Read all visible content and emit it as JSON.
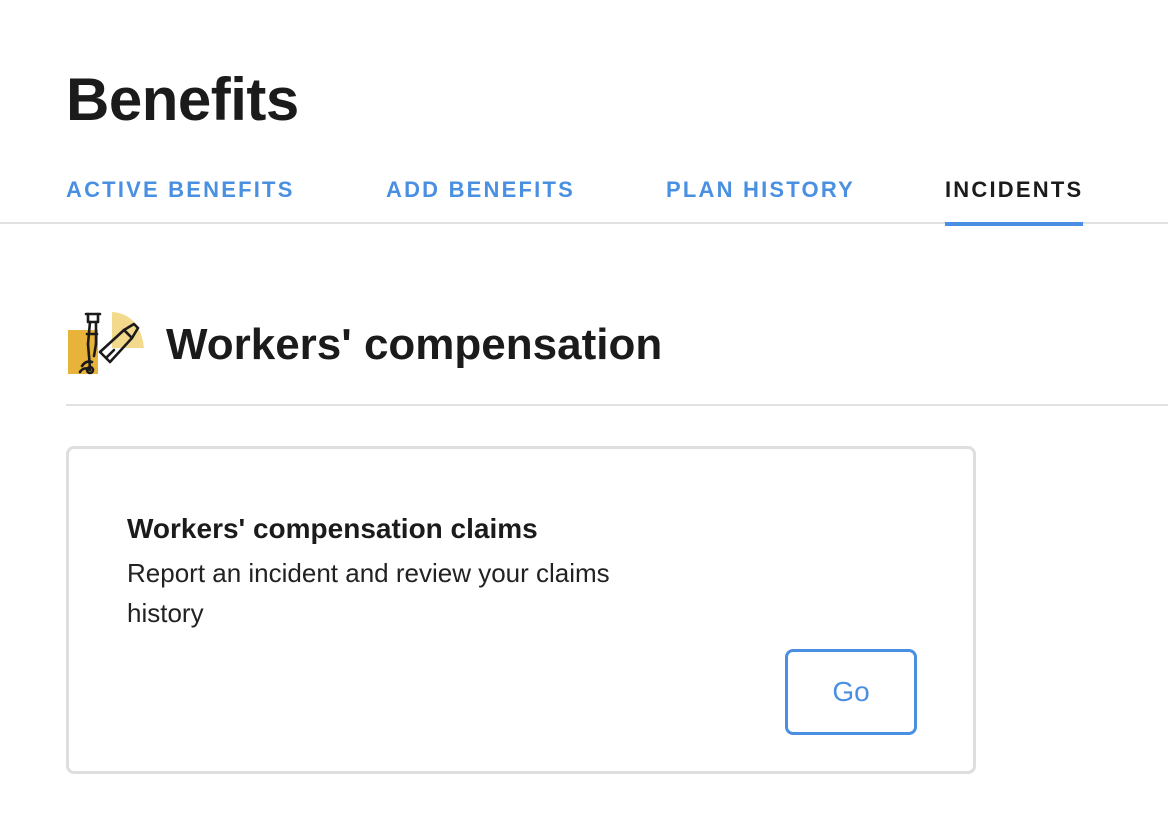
{
  "page": {
    "title": "Benefits"
  },
  "tabs": [
    {
      "label": "ACTIVE BENEFITS",
      "active": false
    },
    {
      "label": "ADD BENEFITS",
      "active": false
    },
    {
      "label": "PLAN HISTORY",
      "active": false
    },
    {
      "label": "INCIDENTS",
      "active": true
    }
  ],
  "section": {
    "icon": "crutch-cast-icon",
    "title": "Workers' compensation"
  },
  "card": {
    "title": "Workers' compensation claims",
    "description": "Report an incident and review your claims history",
    "button_label": "Go"
  },
  "colors": {
    "accent": "#4a90e2",
    "text": "#1b1b1b",
    "divider": "#e1e1e1",
    "icon_yellow": "#e8b33a"
  }
}
